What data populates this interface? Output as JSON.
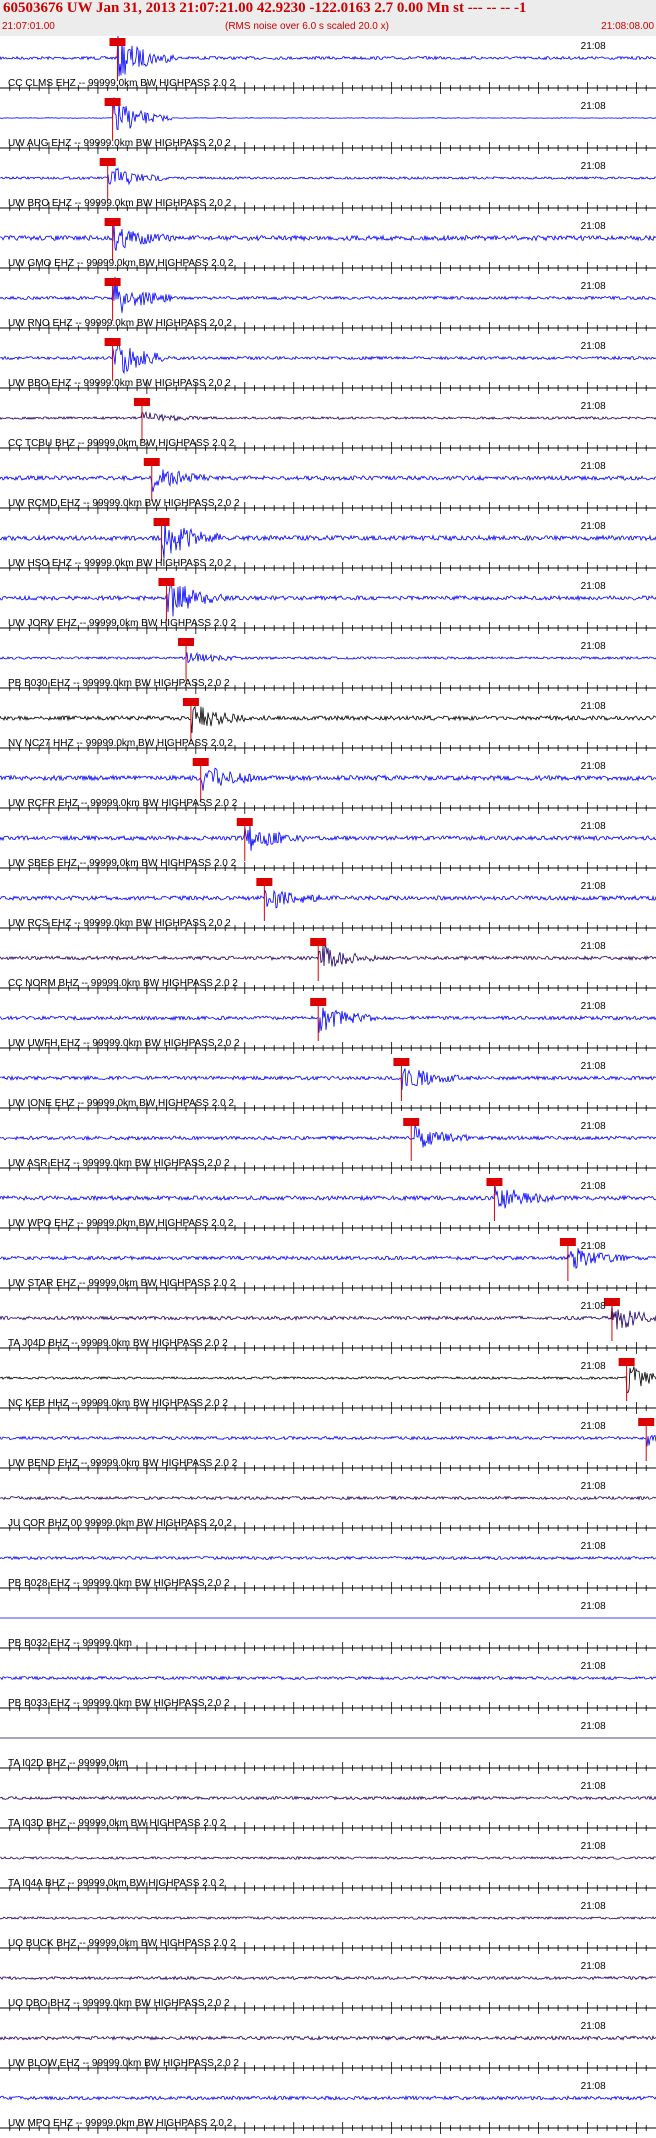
{
  "header": {
    "title": "60503676 UW Jan 31, 2013 21:07:21.00   42.9230 -122.0163  2.7 0.00 Mn st --- -- --   -1",
    "note": "(RMS noise over 6.0 s scaled 20.0 x)",
    "start_time": "21:07:01.00",
    "end_time": "21:08:08.00"
  },
  "colors": {
    "trace_default": "#0000ff",
    "trace_dark": "#000000",
    "trace_purple": "#220066",
    "pick_box": "#dd0000",
    "axis": "#000000"
  },
  "chart_data": {
    "type": "seismogram",
    "time_axis": {
      "start": "21:07:01.00",
      "end": "21:08:08.00",
      "minute_label": "21:08"
    },
    "traces": [
      {
        "label": "CC CLMS EHZ -- 99999.0km BW  HIGHPASS  2.0  2",
        "color": "#0000ff",
        "pick": true,
        "pick_time": 12,
        "amp": "high",
        "noise": 0.25
      },
      {
        "label": "UW AUG EHZ -- 99999.0km BW  HIGHPASS  2.0  2",
        "color": "#0000ff",
        "pick": true,
        "pick_time": 11.5,
        "amp": "clipped",
        "noise": 0.05
      },
      {
        "label": "UW BRO EHZ -- 99999.0km BW  HIGHPASS  2.0  2",
        "color": "#0000ff",
        "pick": true,
        "pick_time": 11,
        "amp": "med",
        "noise": 0.2
      },
      {
        "label": "UW GMO EHZ -- 99999.0km BW  HIGHPASS  2.0  2",
        "color": "#0000ff",
        "pick": true,
        "pick_time": 11.5,
        "amp": "med",
        "noise": 0.4
      },
      {
        "label": "UW RNO EHZ -- 99999.0km BW  HIGHPASS  2.0  2",
        "color": "#0000ff",
        "pick": true,
        "pick_time": 11.5,
        "amp": "high",
        "noise": 0.25
      },
      {
        "label": "UW BBO EHZ -- 99999.0km BW  HIGHPASS  2.0  2",
        "color": "#0000ff",
        "pick": true,
        "pick_time": 11.5,
        "amp": "high",
        "noise": 0.25
      },
      {
        "label": "CC TCBU BHZ -- 99999.0km BW  HIGHPASS  2.0  2",
        "color": "#220066",
        "pick": true,
        "pick_time": 14.5,
        "amp": "low",
        "noise": 0.2
      },
      {
        "label": "UW RCMD EHZ -- 99999.0km BW  HIGHPASS  2.0  2",
        "color": "#0000ff",
        "pick": true,
        "pick_time": 15.5,
        "amp": "med",
        "noise": 0.35
      },
      {
        "label": "UW HSO EHZ -- 99999.0km BW  HIGHPASS  2.0  2",
        "color": "#0000ff",
        "pick": true,
        "pick_time": 16.5,
        "amp": "high",
        "noise": 0.4
      },
      {
        "label": "UW JORV EHZ -- 99999.0km BW  HIGHPASS  2.0  2",
        "color": "#0000ff",
        "pick": true,
        "pick_time": 17,
        "amp": "high",
        "noise": 0.35
      },
      {
        "label": "PB B030 EHZ -- 99999.0km BW  HIGHPASS  2.0  2",
        "color": "#0000ff",
        "pick": true,
        "pick_time": 19,
        "amp": "low",
        "noise": 0.2
      },
      {
        "label": "NV NC27 HHZ -- 99999.0km BW  HIGHPASS  2.0  2",
        "color": "#000000",
        "pick": true,
        "pick_time": 19.5,
        "amp": "med",
        "noise": 0.35
      },
      {
        "label": "UW RCFR EHZ -- 99999.0km BW  HIGHPASS  2.0  2",
        "color": "#0000ff",
        "pick": true,
        "pick_time": 20.5,
        "amp": "med",
        "noise": 0.4
      },
      {
        "label": "UW SBES EHZ -- 99999.0km BW  HIGHPASS  2.0  2",
        "color": "#0000ff",
        "pick": true,
        "pick_time": 25,
        "amp": "med",
        "noise": 0.35
      },
      {
        "label": "UW RCS EHZ -- 99999.0km BW  HIGHPASS  2.0  2",
        "color": "#0000ff",
        "pick": true,
        "pick_time": 27,
        "amp": "med",
        "noise": 0.35
      },
      {
        "label": "CC NORM BHZ -- 99999.0km BW  HIGHPASS  2.0  2",
        "color": "#220066",
        "pick": true,
        "pick_time": 32.5,
        "amp": "med",
        "noise": 0.3
      },
      {
        "label": "UW UWFH EHZ -- 99999.0km BW  HIGHPASS  2.0  2",
        "color": "#0000ff",
        "pick": true,
        "pick_time": 32.5,
        "amp": "med",
        "noise": 0.3
      },
      {
        "label": "UW IONE EHZ -- 99999.0km BW  HIGHPASS  2.0  2",
        "color": "#0000ff",
        "pick": true,
        "pick_time": 41,
        "amp": "med",
        "noise": 0.3
      },
      {
        "label": "UW ASR EHZ -- 99999.0km BW  HIGHPASS  2.0  2",
        "color": "#0000ff",
        "pick": true,
        "pick_time": 42,
        "amp": "med",
        "noise": 0.3
      },
      {
        "label": "UW WPO EHZ -- 99999.0km BW  HIGHPASS  2.0  2",
        "color": "#0000ff",
        "pick": true,
        "pick_time": 50.5,
        "amp": "med",
        "noise": 0.35
      },
      {
        "label": "UW STAR EHZ -- 99999.0km BW  HIGHPASS  2.0  2",
        "color": "#0000ff",
        "pick": true,
        "pick_time": 58,
        "amp": "med",
        "noise": 0.3
      },
      {
        "label": "TA J04D BHZ -- 99999.0km BW  HIGHPASS  2.0  2",
        "color": "#220066",
        "pick": true,
        "pick_time": 62.5,
        "amp": "med",
        "noise": 0.3
      },
      {
        "label": "NC KEB HHZ -- 99999.0km BW  HIGHPASS  2.0  2",
        "color": "#000000",
        "pick": true,
        "pick_time": 64,
        "amp": "med",
        "noise": 0.2
      },
      {
        "label": "UW BEND EHZ -- 99999.0km BW  HIGHPASS  2.0  2",
        "color": "#0000ff",
        "pick": true,
        "pick_time": 66,
        "amp": "med",
        "noise": 0.25
      },
      {
        "label": "JU COR BHZ 00 99999.0km BW  HIGHPASS  2.0  2",
        "color": "#220066",
        "pick": false,
        "amp": "none",
        "noise": 0.25
      },
      {
        "label": "PB B028 EHZ -- 99999.0km BW  HIGHPASS  2.0  2",
        "color": "#0000ff",
        "pick": false,
        "amp": "none",
        "noise": 0.25
      },
      {
        "label": "PB B032 EHZ -- 99999.0km",
        "color": "#0000ff",
        "pick": false,
        "amp": "none",
        "noise": 0.0
      },
      {
        "label": "PB B033 EHZ -- 99999.0km BW  HIGHPASS  2.0  2",
        "color": "#0000ff",
        "pick": false,
        "amp": "none",
        "noise": 0.25
      },
      {
        "label": "TA I02D BHZ -- 99999.0km",
        "color": "#220066",
        "pick": false,
        "amp": "none",
        "noise": 0.0
      },
      {
        "label": "TA I03D BHZ -- 99999.0km BW  HIGHPASS  2.0  2",
        "color": "#220066",
        "pick": false,
        "amp": "none",
        "noise": 0.25
      },
      {
        "label": "TA I04A BHZ -- 99999.0km BW  HIGHPASS  2.0  2",
        "color": "#220066",
        "pick": false,
        "amp": "none",
        "noise": 0.2
      },
      {
        "label": "UO BUCK BHZ -- 99999.0km BW  HIGHPASS  2.0  2",
        "color": "#220066",
        "pick": false,
        "amp": "none",
        "noise": 0.2
      },
      {
        "label": "UO DBO BHZ -- 99999.0km BW  HIGHPASS  2.0  2",
        "color": "#220066",
        "pick": false,
        "amp": "none",
        "noise": 0.25
      },
      {
        "label": "UW BLOW EHZ -- 99999.0km BW  HIGHPASS  2.0  2",
        "color": "#220066",
        "pick": false,
        "amp": "none",
        "noise": 0.3
      },
      {
        "label": "UW MPO EHZ -- 99999.0km BW  HIGHPASS  2.0  2",
        "color": "#0000ff",
        "pick": false,
        "amp": "none",
        "noise": 0.3
      }
    ]
  }
}
